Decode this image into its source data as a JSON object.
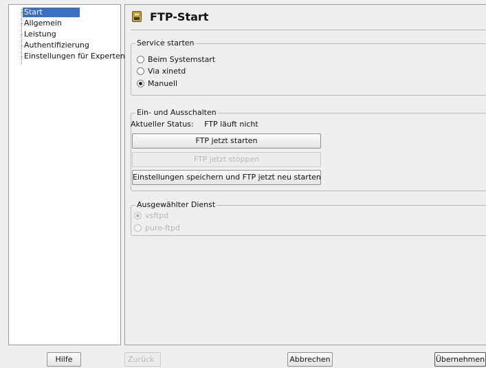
{
  "tree": {
    "items": [
      "Start",
      "Allgemein",
      "Leistung",
      "Authentifizierung",
      "Einstellungen für Experten"
    ],
    "selected_index": 0
  },
  "header": {
    "title": "FTP-Start",
    "icon": "ftp-folder-icon"
  },
  "service_group": {
    "legend": "Service starten",
    "options": [
      "Beim Systemstart",
      "Via xinetd",
      "Manuell"
    ],
    "selected": "Manuell"
  },
  "switch_group": {
    "legend": "Ein- und Ausschalten",
    "status_label": "Aktueller Status:",
    "status_value": "FTP läuft nicht",
    "start_button": "FTP jetzt starten",
    "stop_button": "FTP jetzt stoppen",
    "save_restart_button": "Einstellungen speichern und FTP jetzt neu starten"
  },
  "daemon_group": {
    "legend": "Ausgewählter Dienst",
    "options": [
      "vsftpd",
      "pure-ftpd"
    ],
    "selected": "vsftpd"
  },
  "footer": {
    "help": "Hilfe",
    "back": "Zurück",
    "cancel": "Abbrechen",
    "accept": "Übernehmen"
  },
  "colors": {
    "selection": "#3a6fc4",
    "background": "#efefef"
  }
}
